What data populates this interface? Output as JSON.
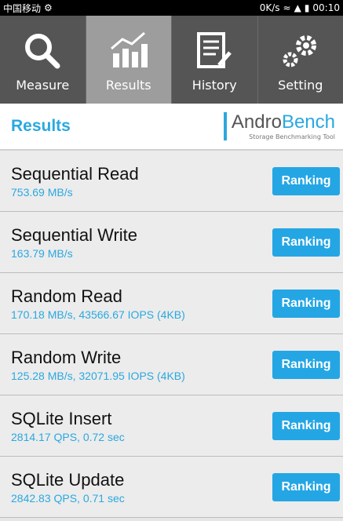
{
  "status": {
    "carrier": "中国移动",
    "speed": "0K/s",
    "time": "00:10"
  },
  "tabs": [
    {
      "label": "Measure",
      "icon": "search-icon"
    },
    {
      "label": "Results",
      "icon": "chart-icon"
    },
    {
      "label": "History",
      "icon": "document-icon"
    },
    {
      "label": "Setting",
      "icon": "gear-icon"
    }
  ],
  "header": {
    "title": "Results",
    "logo_andro": "Andro",
    "logo_bench": "Bench",
    "logo_tagline": "Storage Benchmarking Tool"
  },
  "results": [
    {
      "name": "Sequential Read",
      "value": "753.69 MB/s",
      "button": "Ranking"
    },
    {
      "name": "Sequential Write",
      "value": "163.79 MB/s",
      "button": "Ranking"
    },
    {
      "name": "Random Read",
      "value": "170.18 MB/s, 43566.67 IOPS (4KB)",
      "button": "Ranking"
    },
    {
      "name": "Random Write",
      "value": "125.28 MB/s, 32071.95 IOPS (4KB)",
      "button": "Ranking"
    },
    {
      "name": "SQLite Insert",
      "value": "2814.17 QPS, 0.72 sec",
      "button": "Ranking"
    },
    {
      "name": "SQLite Update",
      "value": "2842.83 QPS, 0.71 sec",
      "button": "Ranking"
    }
  ],
  "colors": {
    "accent": "#2aa8e0",
    "toolbar": "#555555",
    "active_tab": "#9d9d9d"
  }
}
